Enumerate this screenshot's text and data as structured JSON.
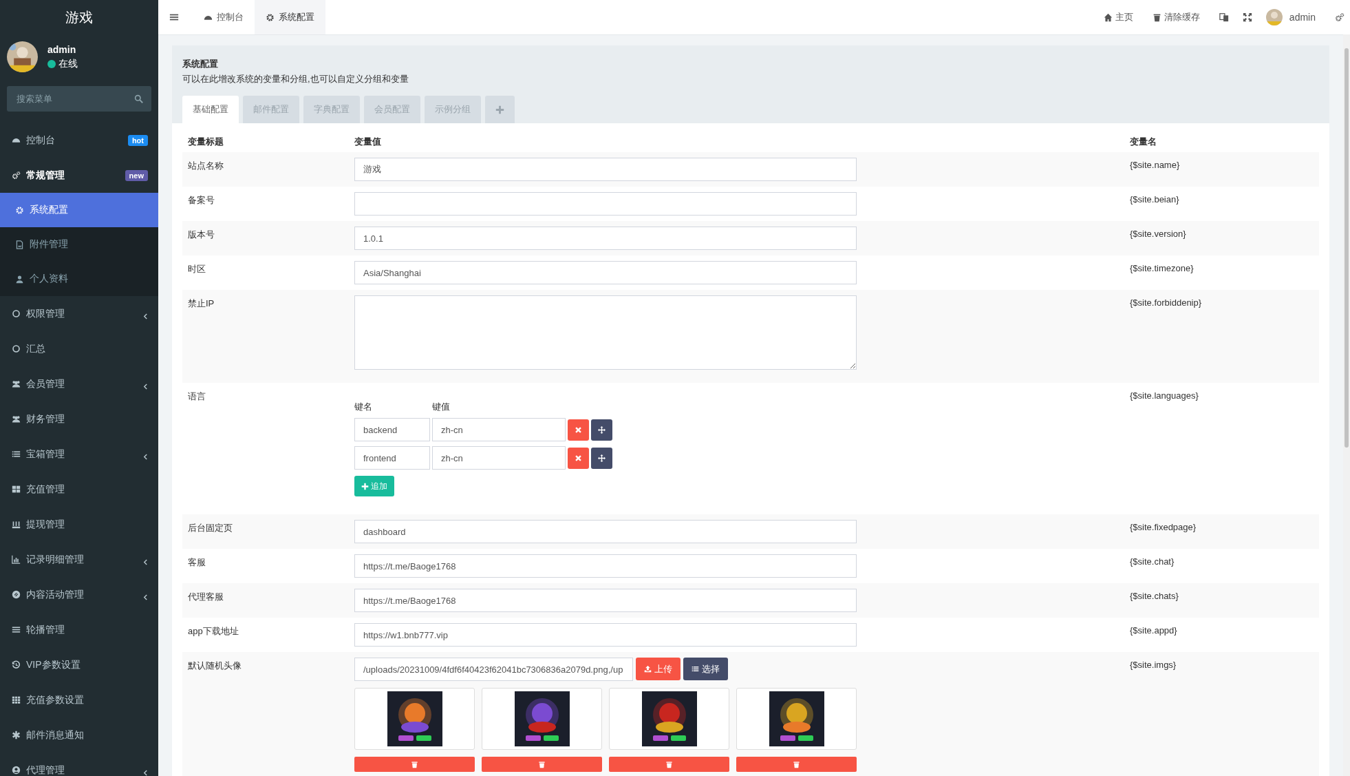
{
  "brand": "游戏",
  "user": {
    "name": "admin",
    "status": "在线",
    "online": true
  },
  "sidebar": {
    "search_placeholder": "搜索菜单",
    "items": [
      {
        "label": "控制台",
        "badge": "hot",
        "color": "#1b8cf2",
        "collapsible": false,
        "expanded": false
      },
      {
        "label": "常规管理",
        "badge": "new",
        "color": "#605ca8",
        "collapsible": false,
        "expanded": true,
        "children": [
          {
            "label": "系统配置",
            "selected": true
          },
          {
            "label": "附件管理",
            "selected": false
          },
          {
            "label": "个人资料",
            "selected": false
          }
        ]
      },
      {
        "label": "权限管理",
        "collapsible": true,
        "expanded": false
      },
      {
        "label": "汇总",
        "collapsible": false,
        "expanded": false
      },
      {
        "label": "会员管理",
        "collapsible": true,
        "expanded": false
      },
      {
        "label": "财务管理",
        "collapsible": false,
        "expanded": false
      },
      {
        "label": "宝箱管理",
        "collapsible": true,
        "expanded": false
      },
      {
        "label": "充值管理",
        "collapsible": false,
        "expanded": false
      },
      {
        "label": "提现管理",
        "collapsible": false,
        "expanded": false
      },
      {
        "label": "记录明细管理",
        "collapsible": true,
        "expanded": false
      },
      {
        "label": "内容活动管理",
        "collapsible": true,
        "expanded": false
      },
      {
        "label": "轮播管理",
        "collapsible": false,
        "expanded": false
      },
      {
        "label": "VIP参数设置",
        "collapsible": false,
        "expanded": false
      },
      {
        "label": "充值参数设置",
        "collapsible": false,
        "expanded": false
      },
      {
        "label": "邮件消息通知",
        "collapsible": false,
        "expanded": false
      },
      {
        "label": "代理管理",
        "collapsible": true,
        "expanded": false
      }
    ]
  },
  "topbar": {
    "tabs": [
      {
        "label": "控制台",
        "selected": false
      },
      {
        "label": "系统配置",
        "selected": true
      }
    ],
    "links": [
      "主页",
      "清除缓存"
    ],
    "user": "admin"
  },
  "page": {
    "title": "系统配置",
    "description": "可以在此增改系统的变量和分组,也可以自定义分组和变量"
  },
  "config_tabs": [
    {
      "label": "基础配置",
      "selected": true
    },
    {
      "label": "邮件配置",
      "selected": false
    },
    {
      "label": "字典配置",
      "selected": false
    },
    {
      "label": "会员配置",
      "selected": false
    },
    {
      "label": "示例分组",
      "selected": false
    }
  ],
  "table": {
    "columns": [
      "变量标题",
      "变量值",
      "变量名"
    ],
    "rows": [
      {
        "kind": "text",
        "title": "站点名称",
        "value": "游戏",
        "var": "{$site.name}"
      },
      {
        "kind": "text",
        "title": "备案号",
        "var": "{$site.beian}"
      },
      {
        "kind": "text",
        "title": "版本号",
        "value": "1.0.1",
        "var": "{$site.version}"
      },
      {
        "kind": "text",
        "title": "时区",
        "value": "Asia/Shanghai",
        "var": "{$site.timezone}"
      },
      {
        "kind": "textarea",
        "title": "禁止IP",
        "var": "{$site.forbiddenip}"
      },
      {
        "kind": "array",
        "title": "语言",
        "key_label": "键名",
        "value_label": "键值",
        "pairs": [
          {
            "key": "backend",
            "value": "zh-cn"
          },
          {
            "key": "frontend",
            "value": "zh-cn"
          }
        ],
        "add_label": "追加",
        "var": "{$site.languages}"
      },
      {
        "kind": "text",
        "title": "后台固定页",
        "value": "dashboard",
        "var": "{$site.fixedpage}"
      },
      {
        "kind": "text",
        "title": "客服",
        "value": "https://t.me/Baoge1768",
        "var": "{$site.chat}"
      },
      {
        "kind": "text",
        "title": "代理客服",
        "value": "https://t.me/Baoge1768",
        "var": "{$site.chats}"
      },
      {
        "kind": "text",
        "title": "app下载地址",
        "value": "https://w1.bnb777.vip",
        "var": "{$site.appd}"
      },
      {
        "kind": "images",
        "title": "默认随机头像",
        "value": "/uploads/20231009/4fdf6f40423f62041bc7306836a2079d.png,/up",
        "upload_label": "上传",
        "select_label": "选择",
        "var": "{$site.imgs}"
      }
    ]
  }
}
